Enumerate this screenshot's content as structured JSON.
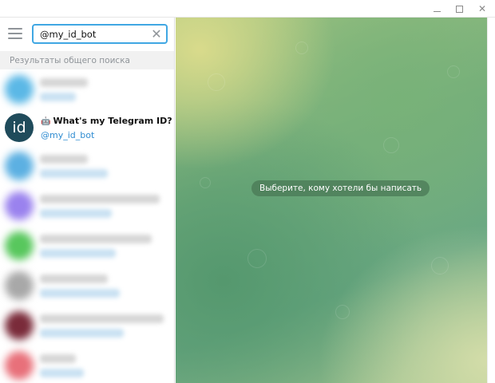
{
  "window": {
    "controls": [
      "minimize-icon",
      "maximize-icon",
      "close-icon"
    ],
    "close_glyph": "✕"
  },
  "sidebar": {
    "menu_icon": "hamburger-menu-icon",
    "search": {
      "value": "@my_id_bot",
      "clear_icon": "close-icon",
      "clear_glyph": "✕"
    },
    "section_header": "Результаты общего поиска",
    "bot_result": {
      "avatar_text": "id",
      "avatar_color": "#1f4b5b",
      "bot_icon": "🤖",
      "name": "What's my Telegram ID?",
      "handle": "@my_id_bot"
    },
    "blurred_avatar_colors": [
      "#5bb8e6",
      "#5cb0e2",
      "#9a82ee",
      "#58c75d",
      "#a8a8a8",
      "#7a2b3a",
      "#e8707a",
      "#5aa5e0"
    ]
  },
  "chat": {
    "empty_message": "Выберите, кому хотели бы написать"
  },
  "colors": {
    "accent": "#40a7e3",
    "link": "#2f8cd1",
    "header_bg": "#f1f1f1"
  }
}
